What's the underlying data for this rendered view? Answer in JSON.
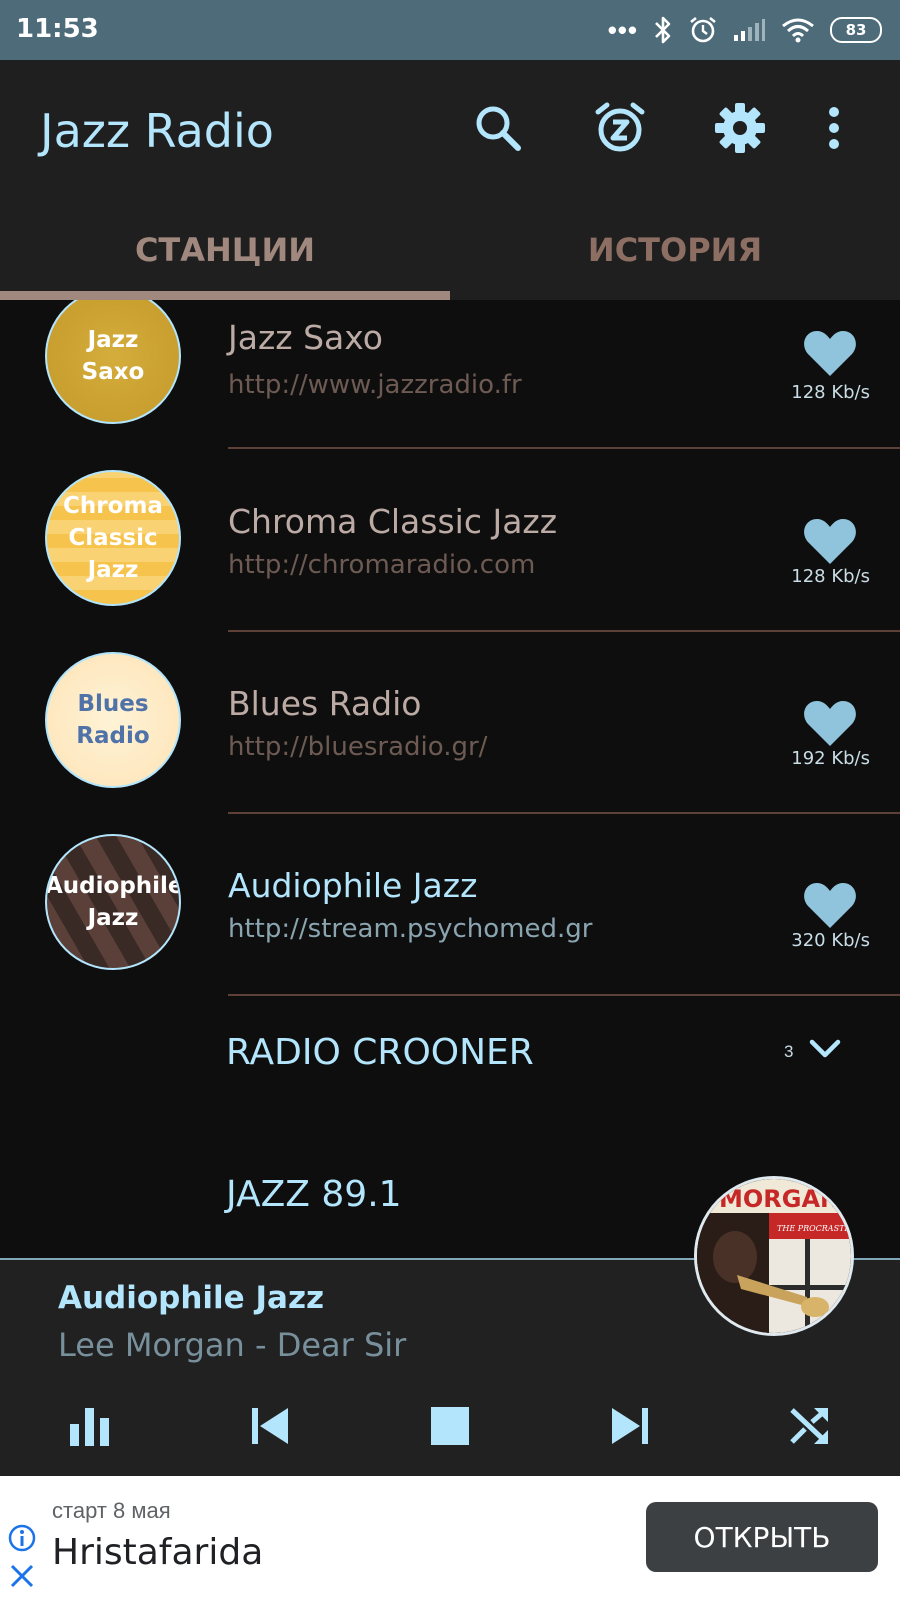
{
  "status_bar": {
    "time": "11:53",
    "battery": "83"
  },
  "app_bar": {
    "title": "Jazz Radio",
    "title_color": "#b3e5fc"
  },
  "tabs": [
    {
      "label": "СТАНЦИИ",
      "selected": true
    },
    {
      "label": "ИСТОРИЯ",
      "selected": false
    }
  ],
  "stations": [
    {
      "name": "Jazz Saxo",
      "url": "http://www.jazzradio.fr",
      "bitrate": "128 Kb/s",
      "logo_text": "Jazz Saxo"
    },
    {
      "name": "Chroma Classic Jazz",
      "url": "http://chromaradio.com",
      "bitrate": "128 Kb/s",
      "logo_text": "Chroma Classic Jazz"
    },
    {
      "name": "Blues Radio",
      "url": "http://bluesradio.gr/",
      "bitrate": "192 Kb/s",
      "logo_text": "Blues Radio"
    },
    {
      "name": "Audiophile Jazz",
      "url": "http://stream.psychomed.gr",
      "bitrate": "320 Kb/s",
      "logo_text": "Audiophile Jazz"
    }
  ],
  "groups": [
    {
      "title": "RADIO CROONER",
      "count": "3"
    },
    {
      "title": "JAZZ 89.1"
    }
  ],
  "player": {
    "station": "Audiophile Jazz",
    "track": "Lee Morgan - Dear Sir",
    "album_text": "MORGAN",
    "album_subtitle": "THE PROCRASTINATOR"
  },
  "ad": {
    "subtitle": "старт 8 мая",
    "title": "Hristafarida",
    "button": "ОТКРЫТЬ"
  }
}
